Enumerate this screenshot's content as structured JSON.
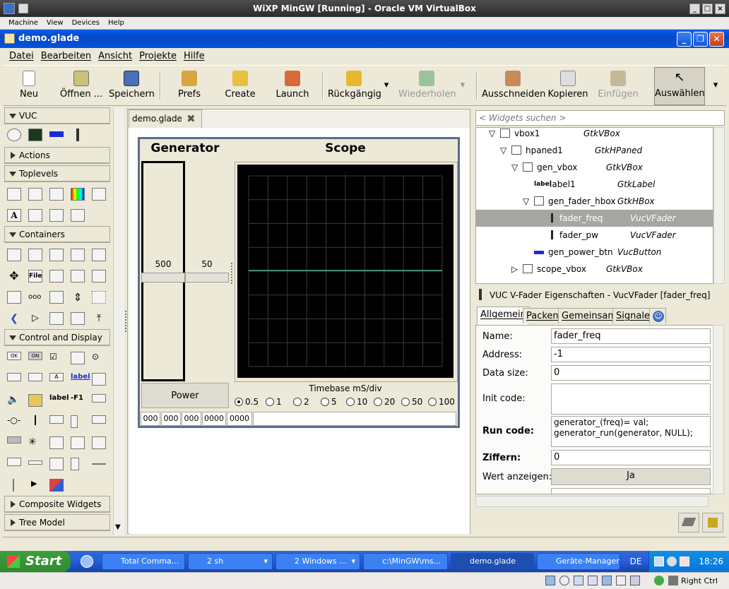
{
  "host": {
    "title": "WiXP MinGW [Running] - Oracle VM VirtualBox",
    "menu": [
      "Machine",
      "View",
      "Devices",
      "Help"
    ],
    "right_ctrl": "Right Ctrl"
  },
  "window": {
    "title": "demo.glade"
  },
  "menu": [
    "Datei",
    "Bearbeiten",
    "Ansicht",
    "Projekte",
    "Hilfe"
  ],
  "toolbar": {
    "new": "Neu",
    "open": "Öffnen ...",
    "save": "Speichern",
    "prefs": "Prefs",
    "create": "Create",
    "launch": "Launch",
    "undo": "Rückgängig",
    "redo": "Wiederholen",
    "cut": "Ausschneiden",
    "copy": "Kopieren",
    "paste": "Einfügen",
    "select": "Auswählen"
  },
  "palette": {
    "groups": [
      "VUC",
      "Actions",
      "Toplevels",
      "Containers",
      "Control and Display",
      "Composite Widgets",
      "Tree Model"
    ],
    "icon_labels": [
      "File",
      "A",
      "label",
      "OK",
      "ON",
      "A",
      "label",
      "label",
      "-F1"
    ]
  },
  "document": {
    "tab": "demo.glade",
    "generator_label": "Generator",
    "scope_label": "Scope",
    "fader1_value": "500",
    "fader2_value": "50",
    "power_button": "Power",
    "timebase_label": "Timebase mS/div",
    "timebase_options": [
      "0.5",
      "1",
      "2",
      "5",
      "10",
      "20",
      "50",
      "100"
    ],
    "timebase_selected": "0.5",
    "segments": [
      "000",
      "000",
      "000",
      "0000",
      "0000"
    ]
  },
  "inspector": {
    "search_placeholder": "< Widgets suchen >",
    "tree": [
      {
        "name": "vbox1",
        "type": "GtkVBox"
      },
      {
        "name": "hpaned1",
        "type": "GtkHPaned"
      },
      {
        "name": "gen_vbox",
        "type": "GtkVBox"
      },
      {
        "name": "label1",
        "type": "GtkLabel",
        "icon_text": "label"
      },
      {
        "name": "gen_fader_hbox",
        "type": "GtkHBox"
      },
      {
        "name": "fader_freq",
        "type": "VucVFader"
      },
      {
        "name": "fader_pw",
        "type": "VucVFader"
      },
      {
        "name": "gen_power_btn",
        "type": "VucButton"
      },
      {
        "name": "scope_vbox",
        "type": "GtkVBox"
      }
    ],
    "selected": "fader_freq"
  },
  "properties": {
    "title": "VUC V-Fader Eigenschaften - VucVFader [fader_freq]",
    "tabs": [
      "Allgemein",
      "Packen",
      "Gemeinsam",
      "Signale"
    ],
    "fields": {
      "name_label": "Name:",
      "name": "fader_freq",
      "address_label": "Address:",
      "address": "-1",
      "datasize_label": "Data size:",
      "datasize": "0",
      "init_label": "Init code:",
      "init": "",
      "run_label": "Run code:",
      "run_line1": "generator_(freq)= val;",
      "run_line2": "generator_run(generator, NULL);",
      "digits_label": "Ziffern:",
      "digits": "0",
      "show_label": "Wert anzeigen:",
      "show": "Ja"
    }
  },
  "taskbar": {
    "start": "Start",
    "tasks": [
      "Total Comma...",
      "2 sh",
      "2 Windows ...",
      "c:\\MinGW\\ms...",
      "demo.glade",
      "Geräte-Manager"
    ],
    "language": "DE",
    "clock": "18:26"
  }
}
